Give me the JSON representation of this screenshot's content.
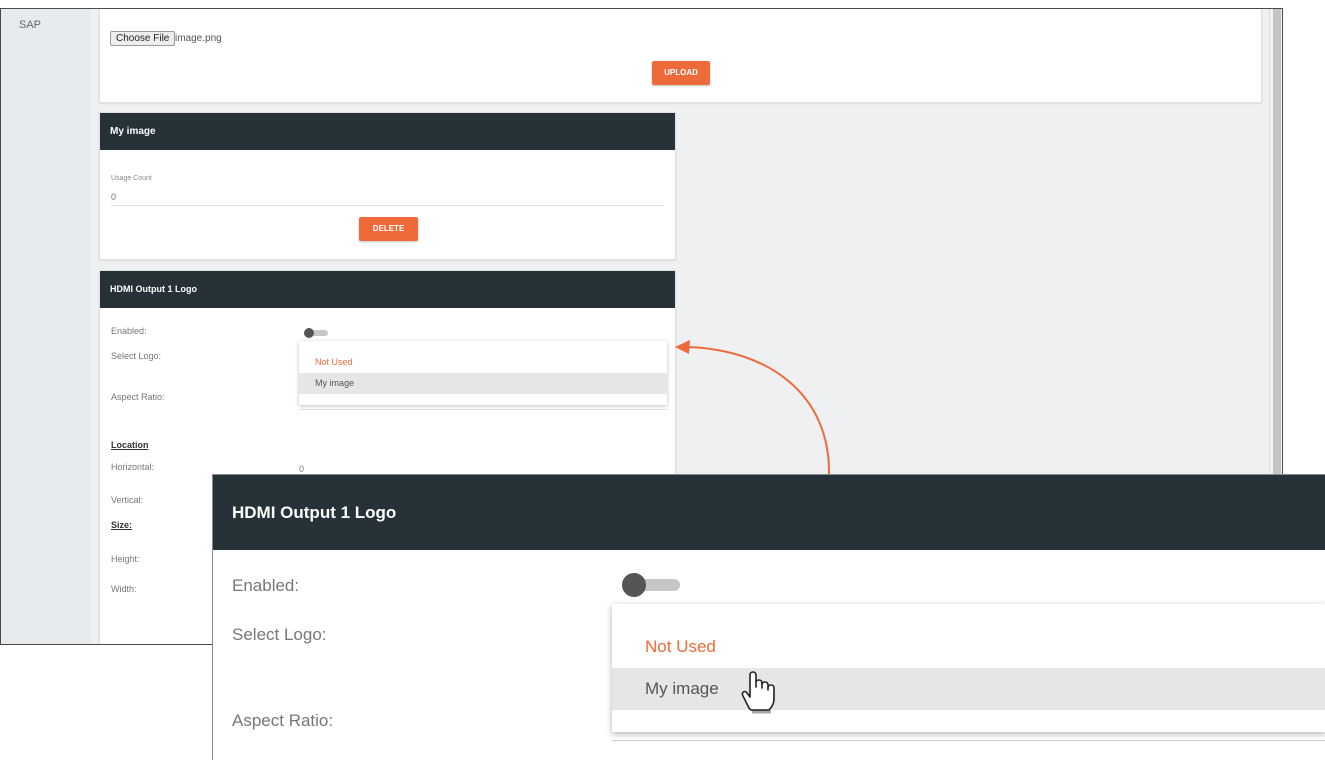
{
  "sidebar": {
    "items": [
      "SAP"
    ]
  },
  "upload": {
    "choose_file_label": "Choose File",
    "file_name": "image.png",
    "upload_label": "UPLOAD"
  },
  "my_image": {
    "title": "My image",
    "usage_count_label": "Usage Count",
    "usage_count_value": "0",
    "delete_label": "DELETE"
  },
  "hdmi": {
    "title": "HDMI Output 1 Logo",
    "enabled_label": "Enabled:",
    "select_logo_label": "Select Logo:",
    "aspect_ratio_label": "Aspect Ratio:",
    "location_label": "Location",
    "horizontal_label": "Horizontal:",
    "horizontal_value": "0",
    "vertical_label": "Vertical:",
    "size_label": "Size:",
    "height_label": "Height:",
    "width_label": "Width:",
    "enabled": false,
    "options": [
      "Not Used",
      "My image"
    ],
    "selected_option": "Not Used",
    "hovered_option": "My image"
  },
  "zoom": {
    "title": "HDMI Output 1 Logo",
    "enabled_label": "Enabled:",
    "select_logo_label": "Select Logo:",
    "aspect_ratio_label": "Aspect Ratio:",
    "options": [
      "Not Used",
      "My image"
    ]
  },
  "colors": {
    "accent": "#ef6a3a",
    "header": "#263238"
  },
  "icons": {
    "cursor": "hand-pointer-icon"
  }
}
